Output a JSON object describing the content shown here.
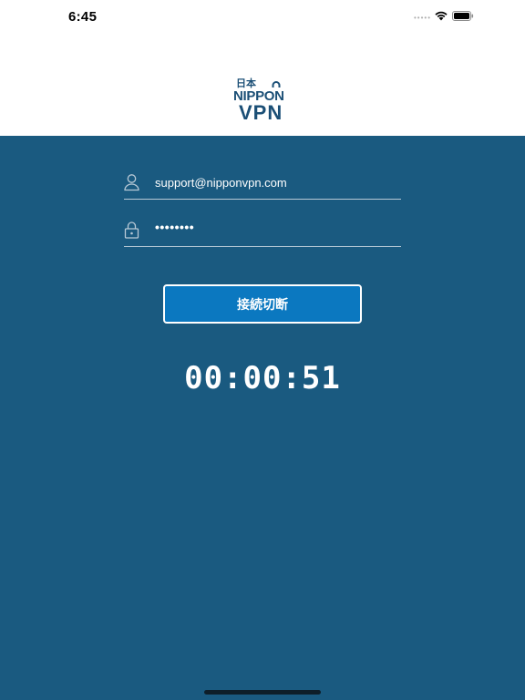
{
  "status_bar": {
    "time": "6:45",
    "dots": "•••••"
  },
  "logo": {
    "kanji": "日本",
    "line1": "NIPPON",
    "line2": "VPN"
  },
  "form": {
    "email_value": "support@nipponvpn.com",
    "password_value": "••••••••"
  },
  "button": {
    "disconnect_label": "接続切断"
  },
  "timer": {
    "value": "00:00:51"
  },
  "colors": {
    "brand": "#1b4f76",
    "background": "#1a5a80",
    "button": "#0b78c0"
  }
}
